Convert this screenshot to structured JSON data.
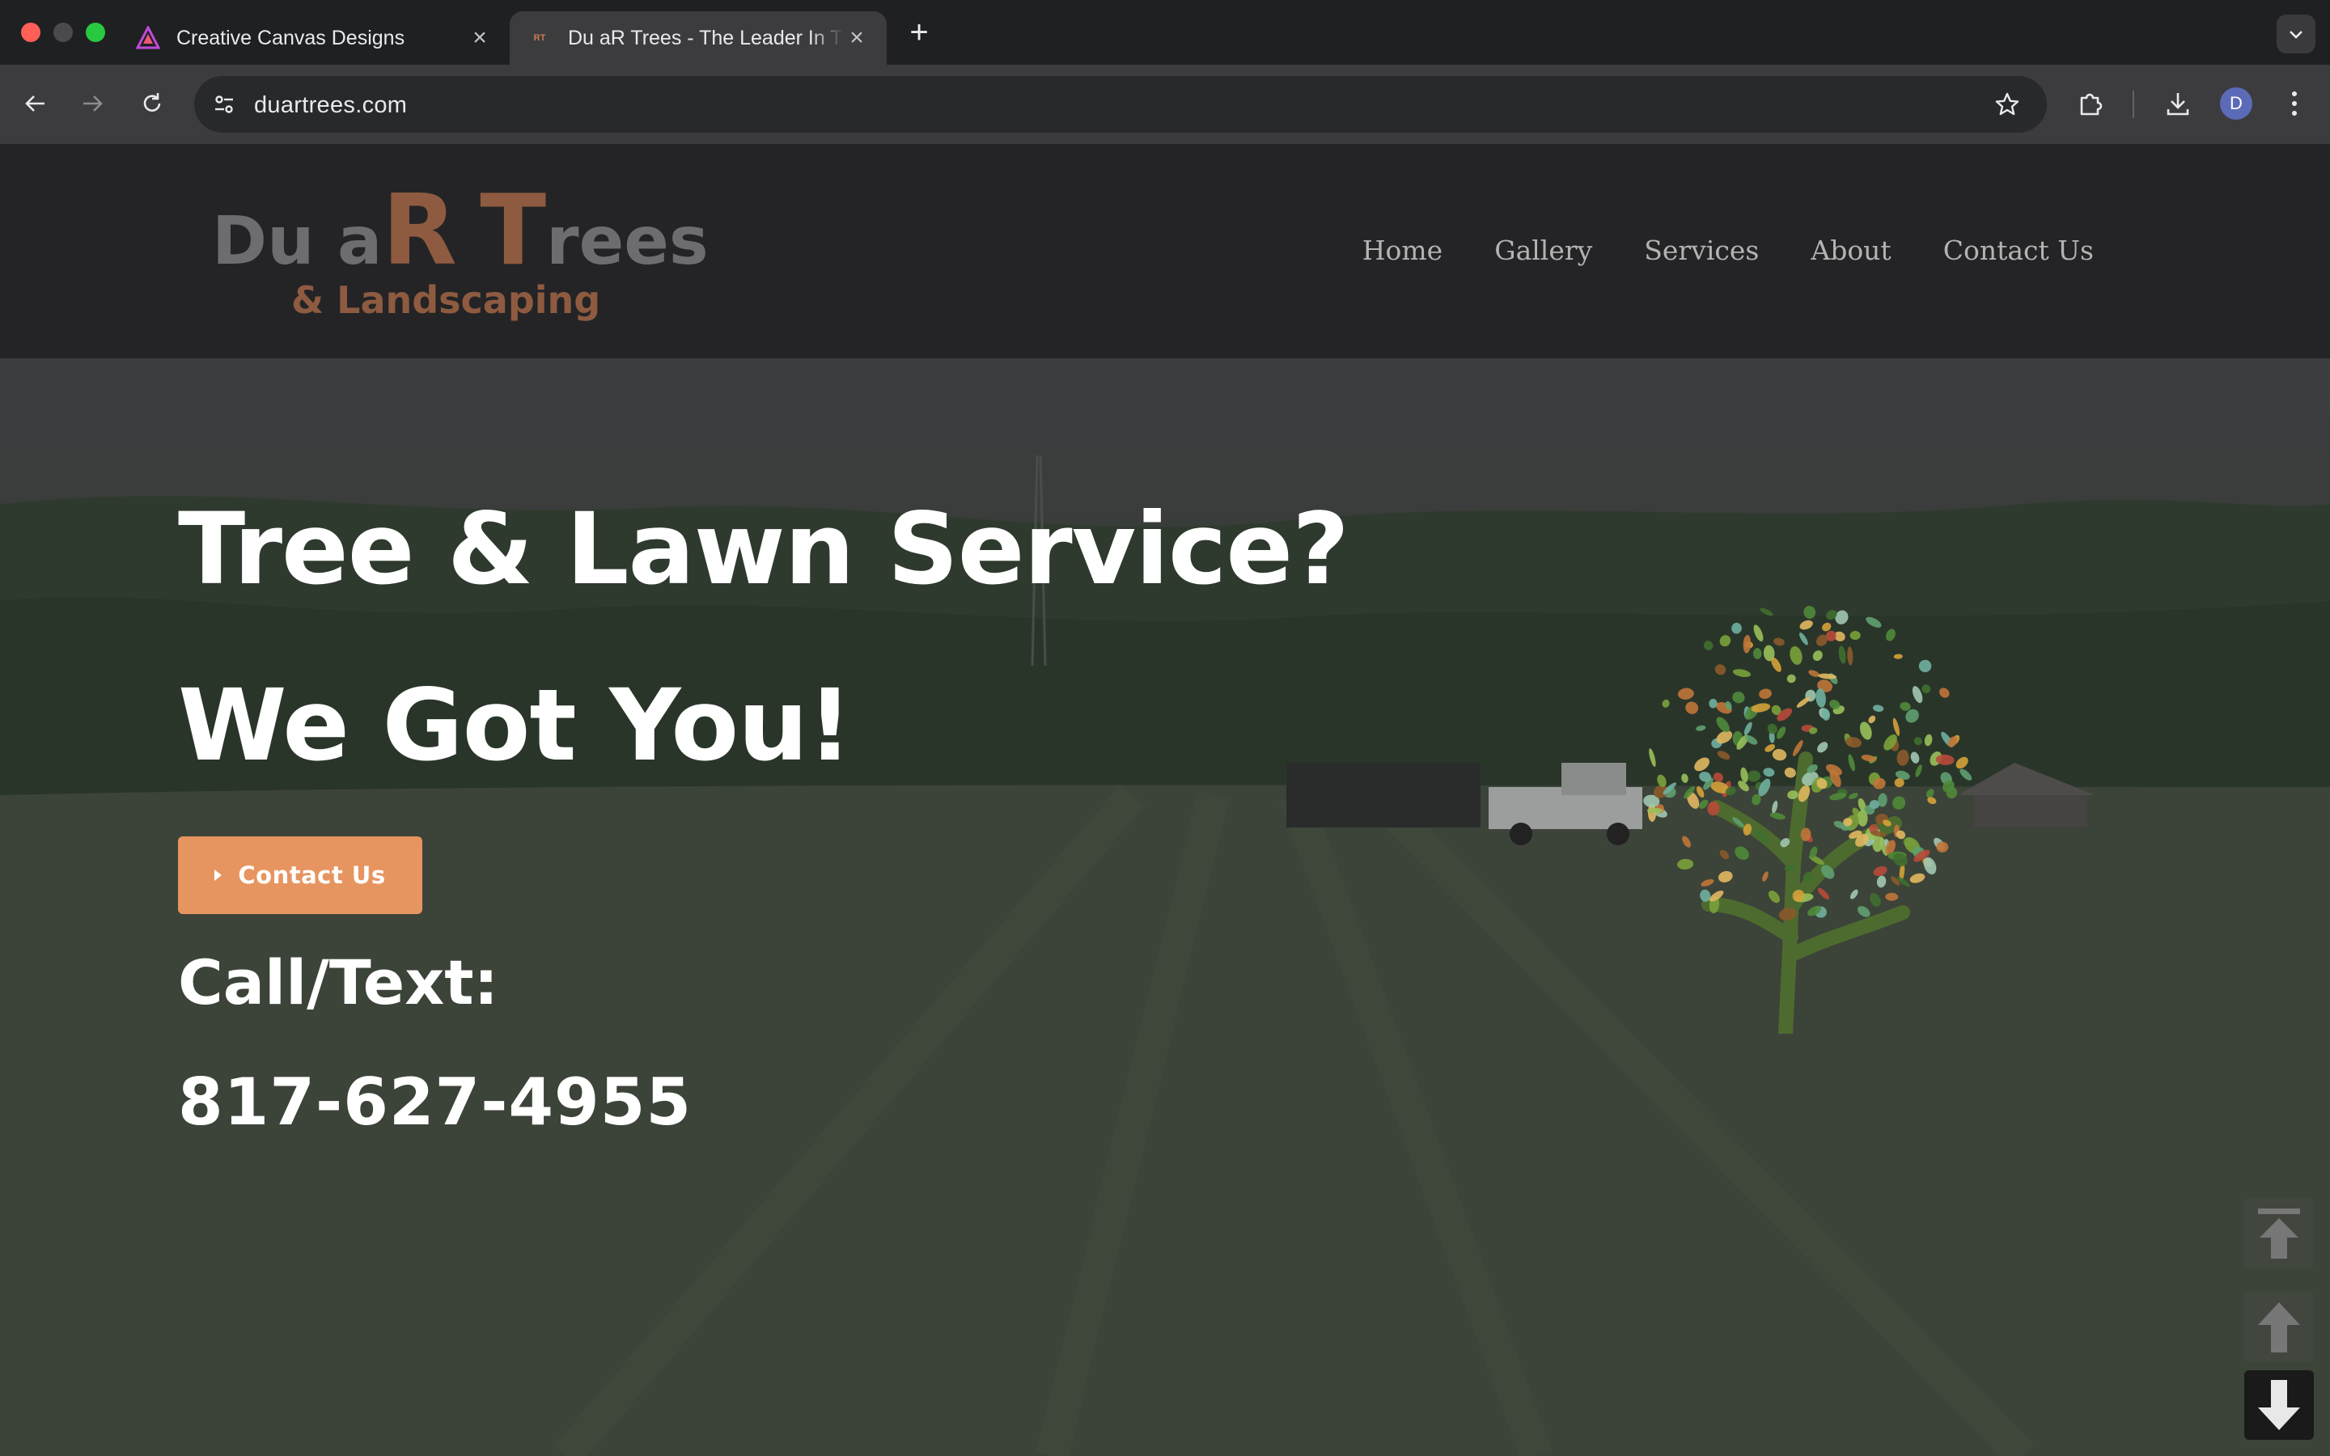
{
  "browser": {
    "tabs": [
      {
        "title": "Creative Canvas Designs",
        "icon": "creative-canvas-favicon"
      },
      {
        "title": "Du aR Trees - The Leader In Tree & Lawn Service",
        "icon": "rt-favicon",
        "favicon_text": "RT",
        "active": true
      }
    ],
    "url": "duartrees.com",
    "profile_initial": "D"
  },
  "site": {
    "logo": {
      "part1": "Du a",
      "part2": "R",
      "part3": " ",
      "part4": "T",
      "part5": "rees",
      "subtitle": "& Landscaping"
    },
    "nav": [
      "Home",
      "Gallery",
      "Services",
      "About",
      "Contact Us"
    ],
    "hero": {
      "headline1": "Tree & Lawn Service?",
      "headline2": "We Got You!",
      "cta_label": "Contact Us",
      "call_label": "Call/Text:",
      "phone": "817-627-4955"
    }
  },
  "colors": {
    "accent": "#e79560",
    "logo_brown": "#8e5b40",
    "header_bg": "#242426"
  }
}
